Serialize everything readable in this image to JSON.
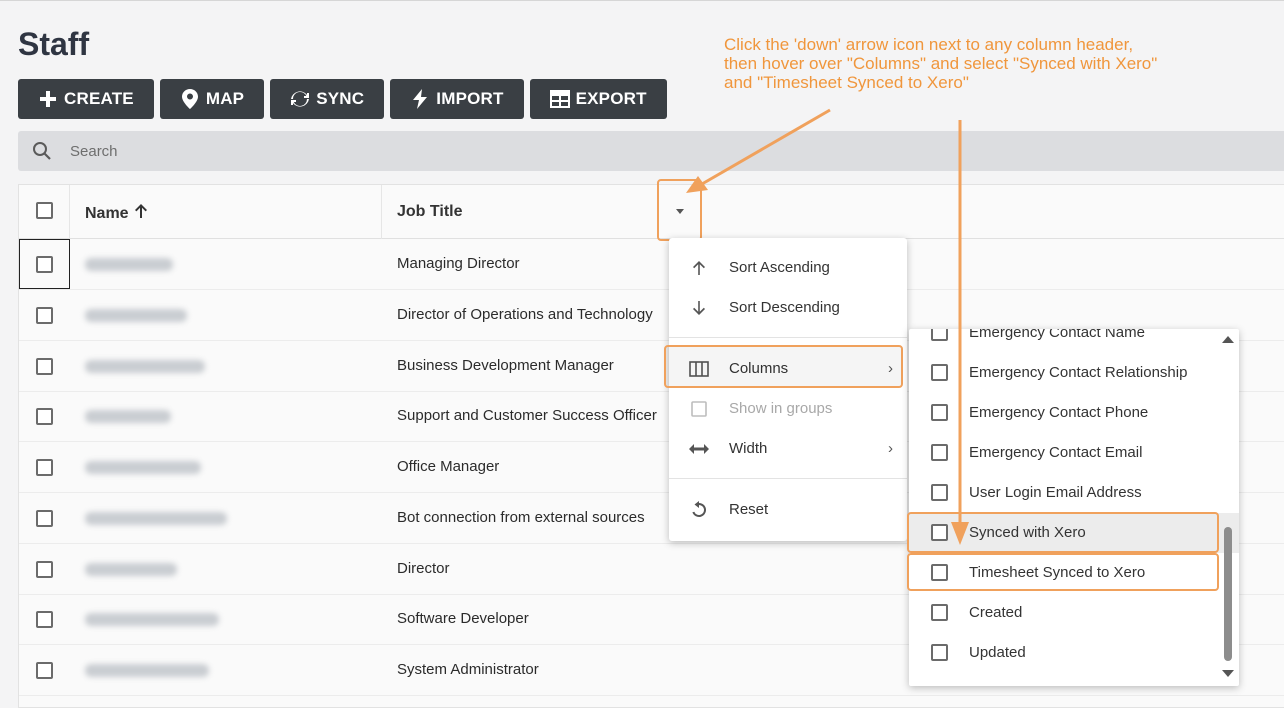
{
  "page": {
    "title": "Staff"
  },
  "toolbar": {
    "buttons": [
      {
        "label": "CREATE",
        "icon": "plus-icon"
      },
      {
        "label": "MAP",
        "icon": "map-pin-icon"
      },
      {
        "label": "SYNC",
        "icon": "sync-icon"
      },
      {
        "label": "IMPORT",
        "icon": "lightning-icon"
      },
      {
        "label": "EXPORT",
        "icon": "table-icon"
      }
    ]
  },
  "search": {
    "placeholder": "Search",
    "value": "",
    "icon": "search-icon"
  },
  "grid": {
    "columns": [
      {
        "label": "Name",
        "sort": "ascending",
        "icon": "arrow-up-icon"
      },
      {
        "label": "Job Title"
      }
    ],
    "rows": [
      {
        "name": "",
        "job_title": "Managing Director"
      },
      {
        "name": "",
        "job_title": "Director of Operations and Technology"
      },
      {
        "name": "",
        "job_title": "Business Development Manager"
      },
      {
        "name": "",
        "job_title": "Support and Customer Success Officer"
      },
      {
        "name": "",
        "job_title": "Office Manager"
      },
      {
        "name": "",
        "job_title": "Bot connection from external sources"
      },
      {
        "name": "",
        "job_title": "Director"
      },
      {
        "name": "",
        "job_title": "Software Developer"
      },
      {
        "name": "",
        "job_title": "System Administrator"
      }
    ]
  },
  "column_menu": {
    "items": [
      {
        "label": "Sort Ascending",
        "icon": "arrow-up-icon"
      },
      {
        "label": "Sort Descending",
        "icon": "arrow-down-icon"
      },
      {
        "label": "Columns",
        "icon": "columns-icon",
        "submenu": true
      },
      {
        "label": "Show in groups",
        "icon": "checkbox-icon",
        "disabled": true
      },
      {
        "label": "Width",
        "icon": "width-icon",
        "submenu": true
      },
      {
        "label": "Reset",
        "icon": "reset-icon"
      }
    ]
  },
  "columns_submenu": {
    "items": [
      {
        "label": "Emergency Contact Name",
        "checked": false
      },
      {
        "label": "Emergency Contact Relationship",
        "checked": false
      },
      {
        "label": "Emergency Contact Phone",
        "checked": false
      },
      {
        "label": "Emergency Contact Email",
        "checked": false
      },
      {
        "label": "User Login Email Address",
        "checked": false
      },
      {
        "label": "Synced with Xero",
        "checked": false
      },
      {
        "label": "Timesheet Synced to Xero",
        "checked": false
      },
      {
        "label": "Created",
        "checked": false
      },
      {
        "label": "Updated",
        "checked": false
      }
    ]
  },
  "annotation": {
    "lines": [
      "Click the 'down' arrow icon next to any column header,",
      "then hover over \"Columns\" and select \"Synced with Xero\"",
      "and \"Timesheet Synced to Xero\""
    ],
    "color": "#f0963c"
  }
}
